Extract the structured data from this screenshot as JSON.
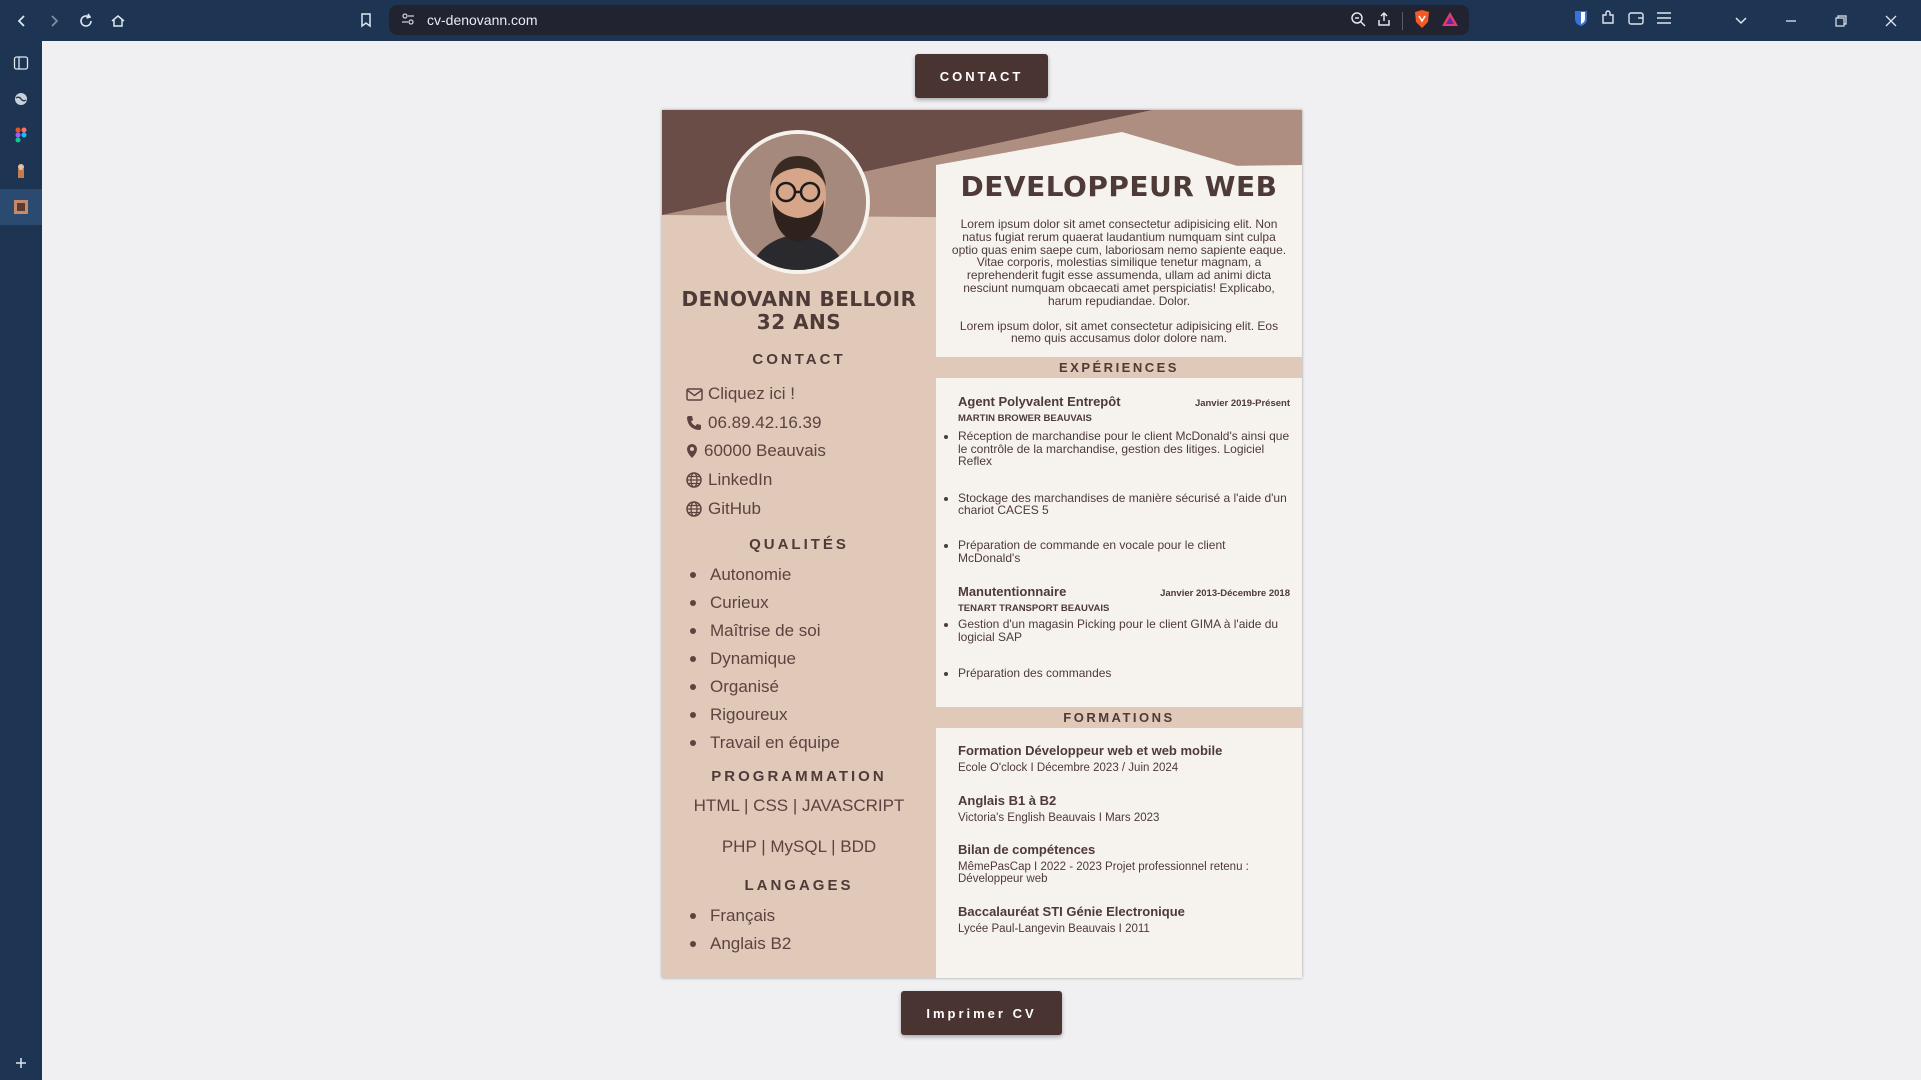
{
  "browser": {
    "url": "cv-denovann.com"
  },
  "page": {
    "contact_button": "CONTACT",
    "print_button": "Imprimer CV"
  },
  "cv": {
    "name": "DENOVANN BELLOIR",
    "age": "32 ANS",
    "contact_title": "CONTACT",
    "contact": [
      {
        "icon": "envelope-icon",
        "label": "Cliquez ici !"
      },
      {
        "icon": "phone-icon",
        "label": "06.89.42.16.39"
      },
      {
        "icon": "location-pin-icon",
        "label": "60000 Beauvais"
      },
      {
        "icon": "globe-icon",
        "label": "LinkedIn"
      },
      {
        "icon": "globe-icon",
        "label": "GitHub"
      }
    ],
    "qualities_title": "QUALITÉS",
    "qualities": [
      "Autonomie",
      "Curieux",
      "Maîtrise de soi",
      "Dynamique",
      "Organisé",
      "Rigoureux",
      "Travail en équipe"
    ],
    "programming_title": "PROGRAMMATION",
    "programming": [
      "HTML | CSS | JAVASCRIPT",
      "PHP | MySQL | BDD"
    ],
    "languages_title": "LANGAGES",
    "languages": [
      "Français",
      "Anglais B2"
    ],
    "job_title": "DEVELOPPEUR WEB",
    "intro": [
      "Lorem ipsum dolor sit amet consectetur adipisicing elit. Non natus fugiat rerum quaerat laudantium numquam sint culpa optio quas enim saepe cum, laboriosam nemo sapiente eaque. Vitae corporis, molestias similique tenetur magnam, a reprehenderit fugit esse assumenda, ullam ad animi dicta nesciunt numquam obcaecati amet perspiciatis! Explicabo, harum repudiandae. Dolor.",
      "Lorem ipsum dolor, sit amet consectetur adipisicing elit. Eos nemo quis accusamus dolor dolore nam."
    ],
    "experiences_title": "EXPÉRIENCES",
    "experiences": [
      {
        "title": "Agent Polyvalent Entrepôt",
        "date": "Janvier 2019-Présent",
        "company": "MARTIN BROWER BEAUVAIS",
        "tasks": [
          "Réception de marchandise pour le client McDonald's ainsi que le contrôle de la marchandise, gestion des litiges. Logiciel Reflex",
          "Stockage des marchandises de manière sécurisé a l'aide d'un chariot CACES 5",
          "Préparation de commande en vocale pour le client McDonald's"
        ]
      },
      {
        "title": "Manutentionnaire",
        "date": "Janvier 2013-Décembre 2018",
        "company": "TENART TRANSPORT BEAUVAIS",
        "tasks": [
          "Gestion d'un magasin Picking pour le client GIMA à l'aide du logicial SAP",
          "Préparation des commandes"
        ]
      }
    ],
    "formations_title": "FORMATIONS",
    "formations": [
      {
        "title": "Formation Développeur web et web mobile",
        "detail": "Ecole O'clock I Décembre 2023 / Juin 2024"
      },
      {
        "title": "Anglais B1 à B2",
        "detail": "Victoria's English Beauvais I Mars 2023"
      },
      {
        "title": "Bilan de compétences",
        "detail": "MêmePasCap I 2022 - 2023 Projet professionnel retenu : Développeur web"
      },
      {
        "title": "Baccalauréat STI Génie Electronique",
        "detail": "Lycée Paul-Langevin Beauvais I 2011"
      }
    ]
  },
  "colors": {
    "dark_brown": "#4a3432",
    "header_brown": "#6b4d47",
    "tan": "#e0c9b9",
    "cream": "#f6f3ef",
    "browser_chrome": "#1d3553"
  }
}
